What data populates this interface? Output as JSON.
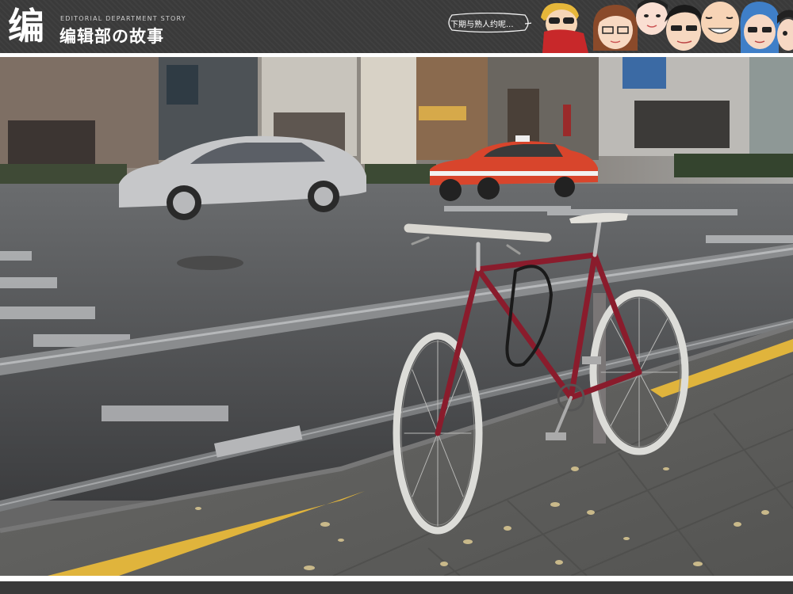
{
  "header": {
    "logo_mark": "编",
    "subtitle": "EDITORIAL DEPARTMENT STORY",
    "title": "编辑部の故事",
    "speech_bubble": "下期与熟人约呢..."
  },
  "photo": {
    "subject": "bicycle-icon"
  },
  "colors": {
    "banner": "#3a3a3a",
    "frame": "#8a1c2c",
    "taxi": "#d8452c",
    "curb_line": "#e0b43c"
  }
}
